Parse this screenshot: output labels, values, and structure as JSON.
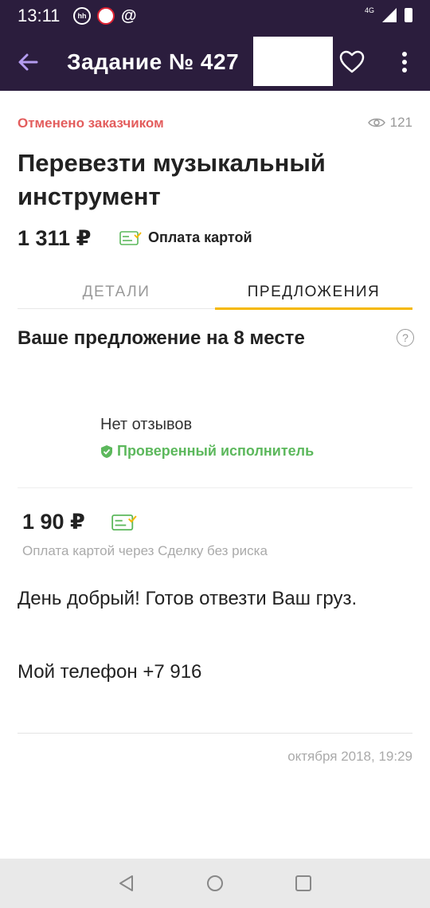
{
  "status_bar": {
    "time": "13:11",
    "icons": [
      "hh-icon",
      "notification-app-icon",
      "at-icon",
      "signal-4g-icon",
      "battery-icon"
    ],
    "network": "4G"
  },
  "app_bar": {
    "title": "Задание № 427",
    "icons": [
      "back-arrow-icon",
      "heart-icon",
      "more-vert-icon"
    ],
    "background": "#2b1d3d"
  },
  "task": {
    "status": "Отменено заказчиком",
    "views": "121",
    "title": "Перевезти музыкальный инструмент",
    "price": "1 311 ₽",
    "payment": "Оплата картой"
  },
  "tabs": [
    {
      "label": "ДЕТАЛИ",
      "active": false
    },
    {
      "label": "ПРЕДЛОЖЕНИЯ",
      "active": true
    }
  ],
  "offer_section": {
    "rank_title": "Ваше предложение на 8 месте",
    "reviews": "Нет отзывов",
    "verified": "Проверенный исполнитель",
    "price": "1   90 ₽",
    "payment_note": "Оплата картой через Сделку без риска",
    "message_1": "День добрый! Готов отвезти Ваш груз.",
    "message_2": "Мой телефон +7 916",
    "timestamp": "октября 2018, 19:29"
  },
  "colors": {
    "accent": "#f5b800",
    "cancel": "#e35d5d",
    "verified": "#5cb85c",
    "back_arrow": "#b49cf0"
  }
}
